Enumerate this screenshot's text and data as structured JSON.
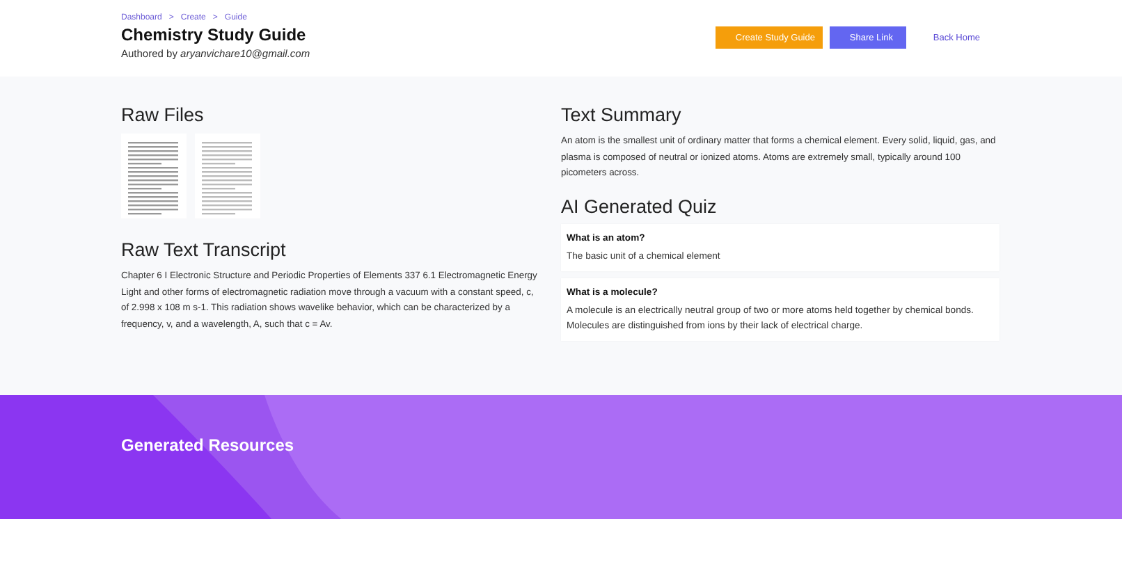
{
  "breadcrumbs": [
    "Dashboard",
    "Create",
    "Guide"
  ],
  "breadcrumb_separator": ">",
  "title": "Chemistry Study Guide",
  "author": "Authored by *aryanvichare10@gmail.com*",
  "actions": [
    {
      "label": "Create Study Guide",
      "kind": "primary"
    },
    {
      "label": "Share Link",
      "kind": "secondary"
    },
    {
      "label": "Back Home",
      "kind": "link"
    }
  ],
  "raw_files": {
    "heading": "Raw Files"
  },
  "transcript": {
    "heading": "Raw Text Transcript",
    "text": "Chapter 6 I Electronic Structure and Periodic Properties of Elements 337 6.1 Electromagnetic Energy Light and other forms of electromagnetic radiation move through a vacuum with a constant speed, c, of 2.998 x 108 m s-1. This radiation shows wavelike behavior, which can be characterized by a frequency, v, and a wavelength, A, such that c = Av."
  },
  "summary": {
    "heading": "Text Summary",
    "text": "An atom is the smallest unit of ordinary matter that forms a chemical element. Every solid, liquid, gas, and plasma is composed of neutral or ionized atoms. Atoms are extremely small, typically around 100 picometers across."
  },
  "quiz": {
    "heading": "AI Generated Quiz",
    "items": [
      {
        "question": "What is an atom?",
        "answer": "The basic unit of a chemical element"
      },
      {
        "question": "What is a molecule?",
        "answer": "A molecule is an electrically neutral group of two or more atoms held together by chemical bonds. Molecules are distinguished from ions by their lack of electrical charge."
      }
    ]
  },
  "resources": {
    "heading": "Generated Resources"
  }
}
